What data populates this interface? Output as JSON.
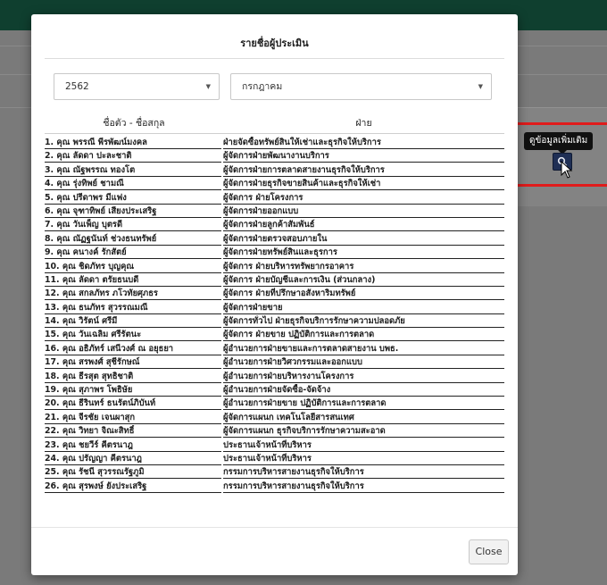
{
  "modal": {
    "title": "รายชื่อผู้ประเมิน",
    "year_select": {
      "value": "2562"
    },
    "month_select": {
      "value": "กรกฎาคม"
    },
    "columns": [
      "ชื่อตัว - ชื่อสกุล",
      "ฝ่าย"
    ],
    "rows": [
      {
        "name": "1. คุณ พรรณี พีรพัฒน์มงคล",
        "dept": "ฝ่ายจัดซื้อทรัพย์สินให้เช่าและธุรกิจให้บริการ"
      },
      {
        "name": "2. คุณ ลัดดา ปะละชาติ",
        "dept": "ผู้จัดการฝ่ายพัฒนางานบริการ"
      },
      {
        "name": "3. คุณ ณัฐพรรณ ทองโต",
        "dept": "ผู้จัดการฝ่ายการตลาดสายงานธุรกิจให้บริการ"
      },
      {
        "name": "4. คุณ รุ่งทิพย์ ชามณี",
        "dept": "ผู้จัดการฝ่ายธุรกิจขายสินค้าและธุรกิจให้เช่า"
      },
      {
        "name": "5. คุณ ปรีดาพร มีแฟง",
        "dept": "ผู้จัดการ ฝ่ายโครงการ"
      },
      {
        "name": "6. คุณ จุฑาทิพย์ เสียงประเสริฐ",
        "dept": "ผู้จัดการฝ่ายออกแบบ"
      },
      {
        "name": "7. คุณ วันเพ็ญ บุตรดี",
        "dept": "ผู้จัดการฝ่ายลูกค้าสัมพันธ์"
      },
      {
        "name": "8. คุณ ณัฏฐนันท์ ช่วงธนทรัพย์",
        "dept": "ผู้จัดการฝ่ายตรวจสอบภายใน"
      },
      {
        "name": "9. คุณ คนางค์ รักสัตย์",
        "dept": "ผู้จัดการฝ่ายทรัพย์สินและธุรการ"
      },
      {
        "name": "10. คุณ ชิดภัทร บุญคุณ",
        "dept": "ผู้จัดการ ฝ่ายบริหารทรัพยากรอาคาร"
      },
      {
        "name": "11. คุณ ลัดดา ตรัยธนบดี",
        "dept": "ผู้จัดการ ฝ่ายบัญชีและการเงิน (ส่วนกลาง)"
      },
      {
        "name": "12. คุณ สกลภัทร ภโวทัยศุภธร",
        "dept": "ผู้จัดการ ฝ่ายที่ปรึกษาอสังหาริมทรัพย์"
      },
      {
        "name": "13. คุณ ธนภัทร สุวรรณมณี",
        "dept": "ผู้จัดการฝ่ายขาย"
      },
      {
        "name": "14. คุณ วิรัตน์ ศรีมี",
        "dept": "ผู้จัดการทั่วไป ฝ่ายธุรกิจบริการรักษาความปลอดภัย"
      },
      {
        "name": "15. คุณ วันเฉลิม ศรีรัตนะ",
        "dept": "ผู้จัดการ ฝ่ายขาย ปฏิบัติการและการตลาด"
      },
      {
        "name": "16. คุณ อธิภัทร์ เสนีวงศ์ ณ อยุธยา",
        "dept": "ผู้อำนวยการฝ่ายขายและการตลาดสายงาน บพธ."
      },
      {
        "name": "17. คุณ สรพงศ์ สุชีรักษณ์",
        "dept": "ผู้อำนวยการฝ่ายวิศวกรรมและออกแบบ"
      },
      {
        "name": "18. คุณ ธีรสุต สุทธิชาติ",
        "dept": "ผู้อำนวยการฝ่ายบริหารงานโครงการ"
      },
      {
        "name": "19. คุณ สุภาพร โพธิษัย",
        "dept": "ผู้อำนวยการฝ่ายจัดซื้อ-จัดจ้าง"
      },
      {
        "name": "20. คุณ ธีรินทร์ ธนรัตน์ภิบันท์",
        "dept": "ผู้อำนวยการฝ่ายขาย ปฏิบัติการและการตลาด"
      },
      {
        "name": "21. คุณ จีรชัย เจนผาสุก",
        "dept": "ผู้จัดการแผนก เทคโนโลยีสารสนเทศ"
      },
      {
        "name": "22. คุณ วิทยา จิณะสิทธิ์",
        "dept": "ผู้จัดการแผนก ธุรกิจบริการรักษาความสะอาด"
      },
      {
        "name": "23. คุณ ชยวีร์ คีตรนาฎ",
        "dept": "ประธานเจ้าหน้าที่บริหาร"
      },
      {
        "name": "24. คุณ ปรัญญา คีตรนาฎ",
        "dept": "ประธานเจ้าหน้าที่บริหาร"
      },
      {
        "name": "25. คุณ รัชนี สุวรรณรัฐภูมิ",
        "dept": "กรรมการบริหารสายงานธุรกิจให้บริการ"
      },
      {
        "name": "26. คุณ สุรพงษ์ ยังประเสริฐ",
        "dept": "กรรมการบริหารสายงานธุรกิจให้บริการ"
      }
    ],
    "close_label": "Close"
  },
  "tooltip": {
    "text": "ดูข้อมูลเพิ่มเติม"
  },
  "icons": {
    "info_button": "search-icon",
    "cursor": "cursor-arrow-icon",
    "dropdown": "caret-down-icon"
  },
  "colors": {
    "highlight_border": "#e01b1b",
    "topbar": "#0f3f2f",
    "info_button_bg": "#1f2f55"
  }
}
